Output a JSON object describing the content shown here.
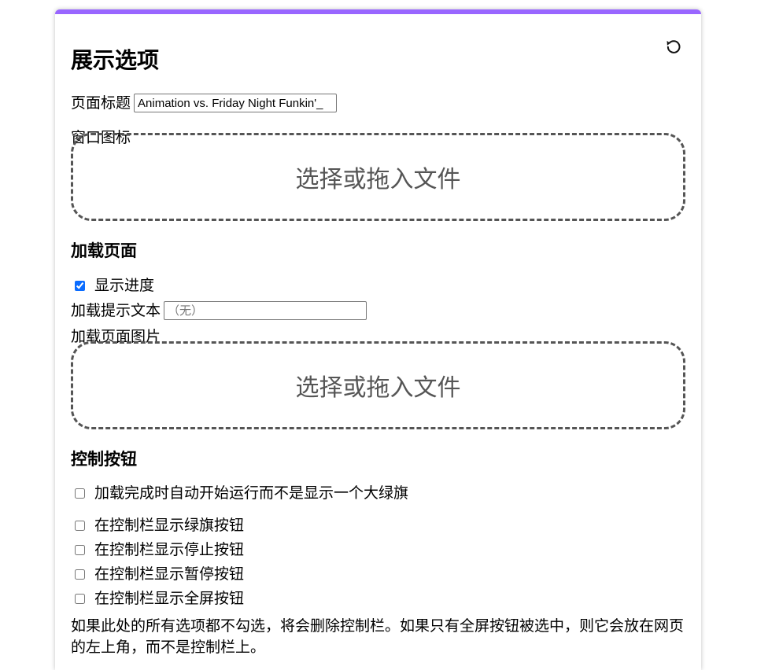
{
  "title": "展示选项",
  "page_title": {
    "label": "页面标题",
    "value": "Animation vs. Friday Night Funkin'_"
  },
  "window_icon": {
    "label": "窗口图标",
    "dropzone_text": "选择或拖入文件"
  },
  "loading": {
    "heading": "加载页面",
    "show_progress_label": "显示进度",
    "loading_text_label": "加载提示文本",
    "loading_text_placeholder": "（无）",
    "image_label": "加载页面图片",
    "dropzone_text": "选择或拖入文件"
  },
  "controls": {
    "heading": "控制按钮",
    "autoplay_label": "加载完成时自动开始运行而不是显示一个大绿旗",
    "green_flag_label": "在控制栏显示绿旗按钮",
    "stop_label": "在控制栏显示停止按钮",
    "pause_label": "在控制栏显示暂停按钮",
    "fullscreen_label": "在控制栏显示全屏按钮",
    "note": "如果此处的所有选项都不勾选，将会删除控制栏。如果只有全屏按钮被选中，则它会放在网页的左上角，而不是控制栏上。"
  },
  "colors": {
    "accent": "#9966ff",
    "checkbox": "#0a6cff"
  },
  "icons": {
    "reset": "reset-icon"
  }
}
